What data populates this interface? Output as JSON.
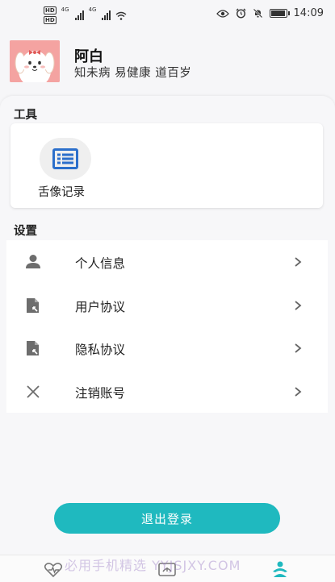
{
  "status_bar": {
    "hd1": "HD",
    "hd2": "HD",
    "net1": "4G",
    "net2": "4G",
    "time": "14:09"
  },
  "profile": {
    "name": "阿白",
    "motto": "知未病  易健康  道百岁"
  },
  "tools": {
    "title": "工具",
    "items": [
      {
        "label": "舌像记录",
        "icon": "list-icon"
      }
    ]
  },
  "settings": {
    "title": "设置",
    "items": [
      {
        "label": "个人信息",
        "icon": "person-icon"
      },
      {
        "label": "用户协议",
        "icon": "document-icon"
      },
      {
        "label": "隐私协议",
        "icon": "document-icon"
      },
      {
        "label": "注销账号",
        "icon": "close-icon"
      }
    ]
  },
  "logout_label": "退出登录",
  "watermark": "必用手机精选 YYJSJXY.COM",
  "colors": {
    "accent": "#1fb9bf",
    "icon_blue": "#2b6fcb",
    "icon_gray": "#6d6d6d"
  }
}
